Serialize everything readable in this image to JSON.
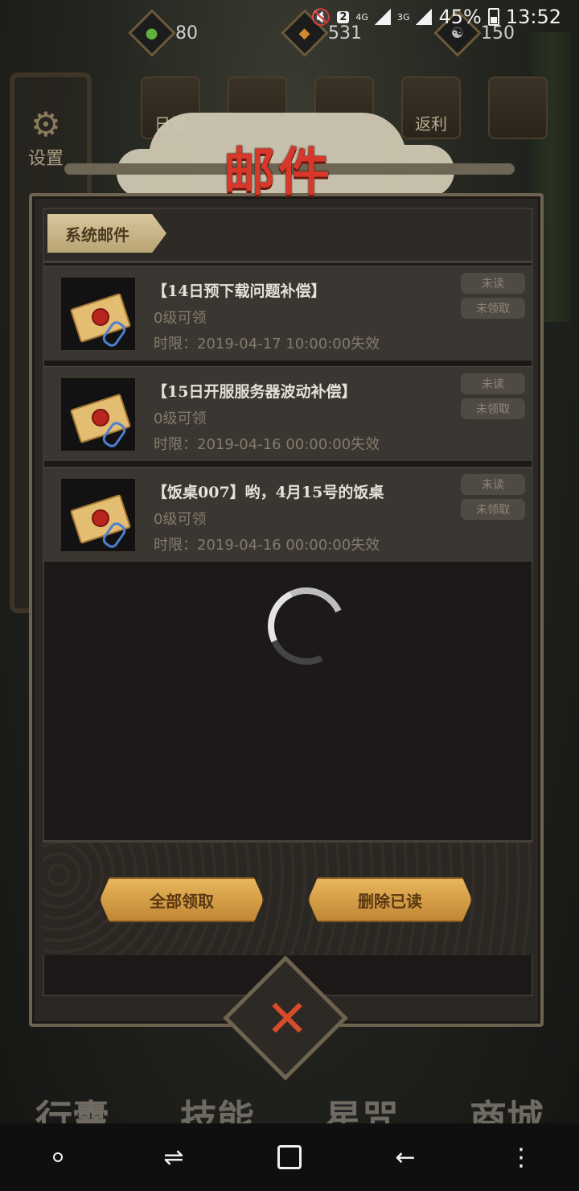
{
  "status_bar": {
    "sim_slot": "2",
    "network_1": "4G",
    "network_2": "3G",
    "battery": "45%",
    "time": "13:52"
  },
  "currencies": [
    {
      "icon": "jade-icon",
      "value": "80",
      "color": "#5fb33a"
    },
    {
      "icon": "coin-icon",
      "value": "531",
      "color": "#d08a2b"
    },
    {
      "icon": "yin-yang-icon",
      "value": "150",
      "color": "#bcbcbc"
    }
  ],
  "top_nav": [
    {
      "label": "日常",
      "icon": "scroll-icon"
    },
    {
      "label": "",
      "icon": "notice-icon"
    },
    {
      "label": "",
      "icon": "shrine-icon"
    },
    {
      "label": "返利",
      "icon": "treasure-icon"
    },
    {
      "label": "",
      "icon": "gift-icon"
    }
  ],
  "side": {
    "settings_label": "设置"
  },
  "modal": {
    "title": "邮件",
    "tab": "系统邮件",
    "mails": [
      {
        "title": "【14日预下载问题补偿】",
        "level": "0级可领",
        "expiry": "时限：2019-04-17 10:00:00失效",
        "status_read": "未读",
        "status_claim": "未领取"
      },
      {
        "title": "【15日开服服务器波动补偿】",
        "level": "0级可领",
        "expiry": "时限：2019-04-16 00:00:00失效",
        "status_read": "未读",
        "status_claim": "未领取"
      },
      {
        "title": "【饭桌007】哟，4月15号的饭桌",
        "level": "0级可领",
        "expiry": "时限：2019-04-16 00:00:00失效",
        "status_read": "未读",
        "status_claim": "未领取"
      }
    ],
    "claim_all_label": "全部领取",
    "delete_read_label": "删除已读",
    "close_icon": "close-x-icon"
  },
  "bottom_nav": [
    "行囊",
    "技能",
    "星咒",
    "商城"
  ],
  "colors": {
    "accent_red": "#d8382a",
    "button_gold": "#d9a04a",
    "panel_border": "#6d6350"
  }
}
